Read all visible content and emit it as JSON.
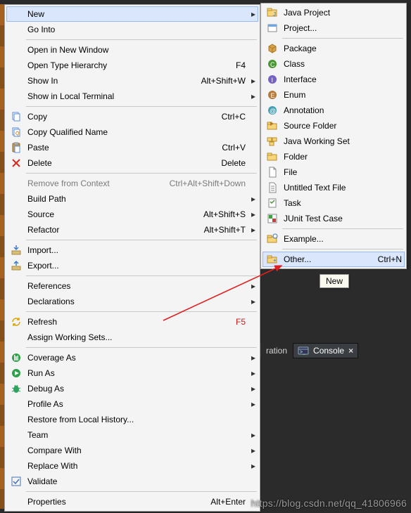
{
  "contextMenu": {
    "items": [
      {
        "label": "New",
        "submenu": true,
        "highlight": true
      },
      {
        "label": "Go Into"
      },
      {
        "sep": true
      },
      {
        "label": "Open in New Window"
      },
      {
        "label": "Open Type Hierarchy",
        "accel": "F4"
      },
      {
        "label": "Show In",
        "accel": "Alt+Shift+W",
        "submenu": true
      },
      {
        "label": "Show in Local Terminal",
        "submenu": true
      },
      {
        "sep": true
      },
      {
        "icon": "copy",
        "label": "Copy",
        "accel": "Ctrl+C"
      },
      {
        "icon": "copy-qualified",
        "label": "Copy Qualified Name"
      },
      {
        "icon": "paste",
        "label": "Paste",
        "accel": "Ctrl+V"
      },
      {
        "icon": "delete",
        "label": "Delete",
        "accel": "Delete"
      },
      {
        "sep": true
      },
      {
        "label": "Remove from Context",
        "accel": "Ctrl+Alt+Shift+Down",
        "disabled": true
      },
      {
        "label": "Build Path",
        "submenu": true
      },
      {
        "label": "Source",
        "accel": "Alt+Shift+S",
        "submenu": true
      },
      {
        "label": "Refactor",
        "accel": "Alt+Shift+T",
        "submenu": true
      },
      {
        "sep": true
      },
      {
        "icon": "import",
        "label": "Import..."
      },
      {
        "icon": "export",
        "label": "Export..."
      },
      {
        "sep": true
      },
      {
        "label": "References",
        "submenu": true
      },
      {
        "label": "Declarations",
        "submenu": true
      },
      {
        "sep": true
      },
      {
        "icon": "refresh",
        "label": "Refresh",
        "accel": "F5"
      },
      {
        "label": "Assign Working Sets..."
      },
      {
        "sep": true
      },
      {
        "icon": "coverage",
        "label": "Coverage As",
        "submenu": true
      },
      {
        "icon": "run",
        "label": "Run As",
        "submenu": true
      },
      {
        "icon": "debug",
        "label": "Debug As",
        "submenu": true
      },
      {
        "label": "Profile As",
        "submenu": true
      },
      {
        "label": "Restore from Local History..."
      },
      {
        "label": "Team",
        "submenu": true
      },
      {
        "label": "Compare With",
        "submenu": true
      },
      {
        "label": "Replace With",
        "submenu": true
      },
      {
        "icon": "validate",
        "label": "Validate"
      },
      {
        "sep": true
      },
      {
        "label": "Properties",
        "accel": "Alt+Enter"
      }
    ]
  },
  "newSubmenu": {
    "items": [
      {
        "icon": "java-proj",
        "label": "Java Project"
      },
      {
        "icon": "project",
        "label": "Project..."
      },
      {
        "sep": true
      },
      {
        "icon": "package",
        "label": "Package"
      },
      {
        "icon": "class",
        "label": "Class"
      },
      {
        "icon": "interface",
        "label": "Interface"
      },
      {
        "icon": "enum",
        "label": "Enum"
      },
      {
        "icon": "annotation",
        "label": "Annotation"
      },
      {
        "icon": "src-folder",
        "label": "Source Folder"
      },
      {
        "icon": "working-set",
        "label": "Java Working Set"
      },
      {
        "icon": "folder",
        "label": "Folder"
      },
      {
        "icon": "file",
        "label": "File"
      },
      {
        "icon": "textfile",
        "label": "Untitled Text File"
      },
      {
        "icon": "task",
        "label": "Task"
      },
      {
        "icon": "junit",
        "label": "JUnit Test Case"
      },
      {
        "sep": true
      },
      {
        "icon": "example",
        "label": "Example..."
      },
      {
        "sep": true
      },
      {
        "icon": "other",
        "label": "Other...",
        "accel": "Ctrl+N",
        "highlight": true
      }
    ]
  },
  "tooltip": {
    "label": "New"
  },
  "tabs": {
    "partial": "ration",
    "active": {
      "label": "Console",
      "icon": "console",
      "close": "×"
    }
  },
  "watermark": "https://blog.csdn.net/qq_41806966"
}
